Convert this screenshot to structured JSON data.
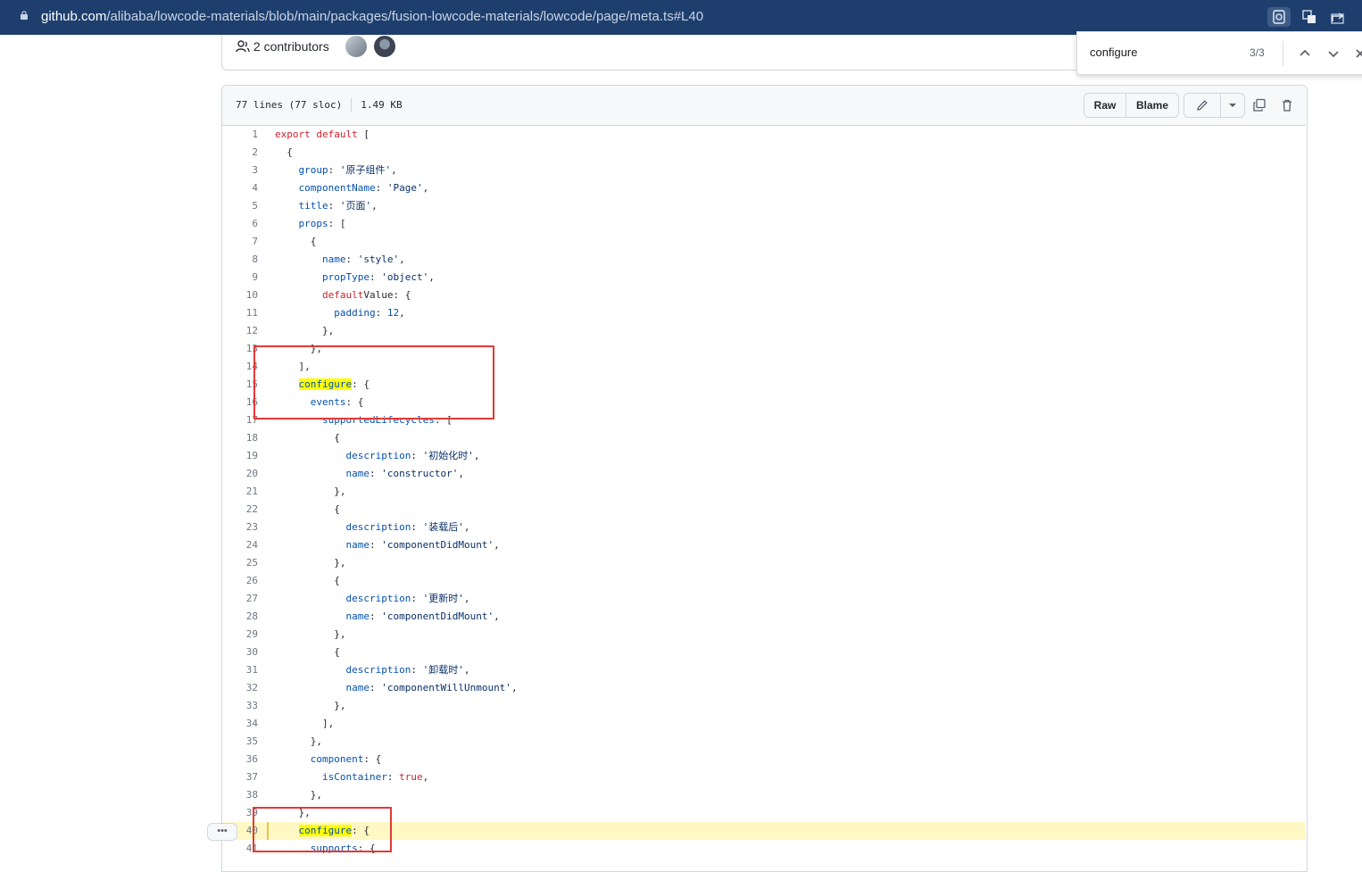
{
  "browser": {
    "url_domain": "github.com",
    "url_path": "/alibaba/lowcode-materials/blob/main/packages/fusion-lowcode-materials/lowcode/page/meta.ts#L40"
  },
  "repo": {
    "contributors": "2 contributors"
  },
  "find": {
    "query": "configure",
    "count": "3/3"
  },
  "file": {
    "lines": "77 lines (77 sloc)",
    "size": "1.49 KB",
    "raw_label": "Raw",
    "blame_label": "Blame",
    "more_label": "•••"
  },
  "code": [
    {
      "n": "1",
      "t": "export default ["
    },
    {
      "n": "2",
      "t": "  {"
    },
    {
      "n": "3",
      "t": "    group: '原子组件',"
    },
    {
      "n": "4",
      "t": "    componentName: 'Page',"
    },
    {
      "n": "5",
      "t": "    title: '页面',"
    },
    {
      "n": "6",
      "t": "    props: ["
    },
    {
      "n": "7",
      "t": "      {"
    },
    {
      "n": "8",
      "t": "        name: 'style',"
    },
    {
      "n": "9",
      "t": "        propType: 'object',"
    },
    {
      "n": "10",
      "t": "        defaultValue: {"
    },
    {
      "n": "11",
      "t": "          padding: 12,"
    },
    {
      "n": "12",
      "t": "        },"
    },
    {
      "n": "13",
      "t": "      },"
    },
    {
      "n": "14",
      "t": "    ],"
    },
    {
      "n": "15",
      "t": "    configure: {"
    },
    {
      "n": "16",
      "t": "      events: {"
    },
    {
      "n": "17",
      "t": "        supportedLifecycles: ["
    },
    {
      "n": "18",
      "t": "          {"
    },
    {
      "n": "19",
      "t": "            description: '初始化时',"
    },
    {
      "n": "20",
      "t": "            name: 'constructor',"
    },
    {
      "n": "21",
      "t": "          },"
    },
    {
      "n": "22",
      "t": "          {"
    },
    {
      "n": "23",
      "t": "            description: '装载后',"
    },
    {
      "n": "24",
      "t": "            name: 'componentDidMount',"
    },
    {
      "n": "25",
      "t": "          },"
    },
    {
      "n": "26",
      "t": "          {"
    },
    {
      "n": "27",
      "t": "            description: '更新时',"
    },
    {
      "n": "28",
      "t": "            name: 'componentDidMount',"
    },
    {
      "n": "29",
      "t": "          },"
    },
    {
      "n": "30",
      "t": "          {"
    },
    {
      "n": "31",
      "t": "            description: '卸载时',"
    },
    {
      "n": "32",
      "t": "            name: 'componentWillUnmount',"
    },
    {
      "n": "33",
      "t": "          },"
    },
    {
      "n": "34",
      "t": "        ],"
    },
    {
      "n": "35",
      "t": "      },"
    },
    {
      "n": "36",
      "t": "      component: {"
    },
    {
      "n": "37",
      "t": "        isContainer: true,"
    },
    {
      "n": "38",
      "t": "      },"
    },
    {
      "n": "39",
      "t": "    },"
    },
    {
      "n": "40",
      "t": "    configure: {",
      "highlighted": true
    },
    {
      "n": "41",
      "t": "      supports: {"
    }
  ]
}
